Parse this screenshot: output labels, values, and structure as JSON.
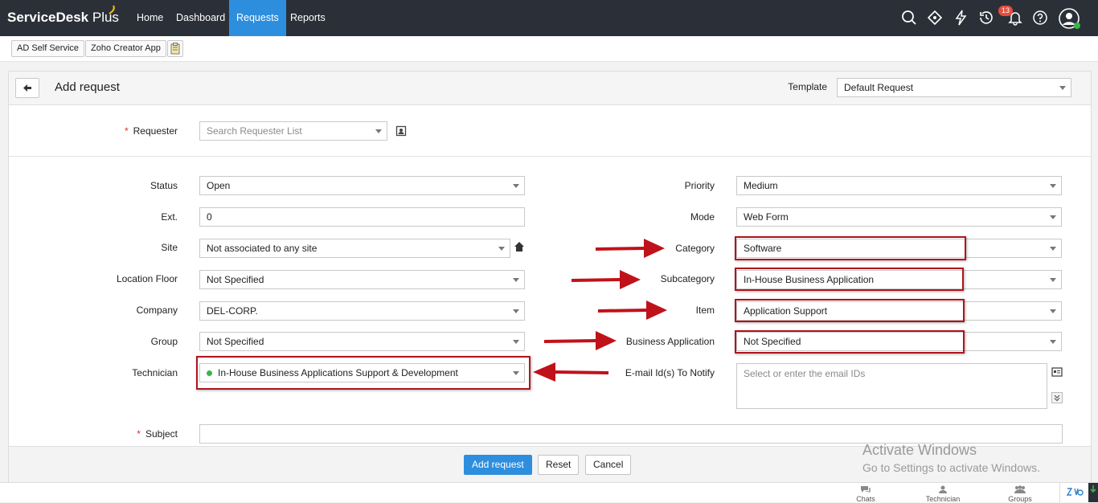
{
  "app": {
    "brand_main": "ServiceDesk",
    "brand_plus": " Plus"
  },
  "nav": {
    "items": [
      {
        "label": "Home"
      },
      {
        "label": "Dashboard"
      },
      {
        "label": "Requests"
      },
      {
        "label": "Reports"
      }
    ]
  },
  "notifications": {
    "count": "13"
  },
  "quick_links": [
    {
      "label": "AD Self Service"
    },
    {
      "label": "Zoho Creator App"
    }
  ],
  "page": {
    "title": "Add request",
    "template_label": "Template",
    "template_value": "Default Request"
  },
  "requester": {
    "label": "Requester",
    "placeholder": "Search Requester List"
  },
  "left_fields": [
    {
      "label": "Status",
      "value": "Open"
    },
    {
      "label": "Ext.",
      "value": "0"
    },
    {
      "label": "Site",
      "value": "Not associated to any site"
    },
    {
      "label": "Location Floor",
      "value": "Not Specified"
    },
    {
      "label": "Company",
      "value": "DEL-CORP."
    },
    {
      "label": "Group",
      "value": "Not Specified"
    },
    {
      "label": "Technician",
      "value": "In-House Business Applications Support & Development"
    }
  ],
  "right_fields": [
    {
      "label": "Priority",
      "value": "Medium"
    },
    {
      "label": "Mode",
      "value": "Web Form"
    },
    {
      "label": "Category",
      "value": "Software"
    },
    {
      "label": "Subcategory",
      "value": "In-House Business Application"
    },
    {
      "label": "Item",
      "value": "Application Support"
    },
    {
      "label": "Business Application",
      "value": "Not Specified"
    },
    {
      "label": "E-mail Id(s) To Notify",
      "placeholder": "Select or enter the email IDs"
    }
  ],
  "subject": {
    "label": "Subject"
  },
  "buttons": {
    "add": "Add request",
    "reset": "Reset",
    "cancel": "Cancel"
  },
  "watermark": {
    "line1": "Activate Windows",
    "line2": "Go to Settings to activate Windows."
  },
  "bottom": {
    "chats": "Chats",
    "technician": "Technician",
    "groups": "Groups"
  },
  "colors": {
    "topbar": "#2b3038",
    "accent": "#2e8ede",
    "highlight": "#b0141c"
  }
}
